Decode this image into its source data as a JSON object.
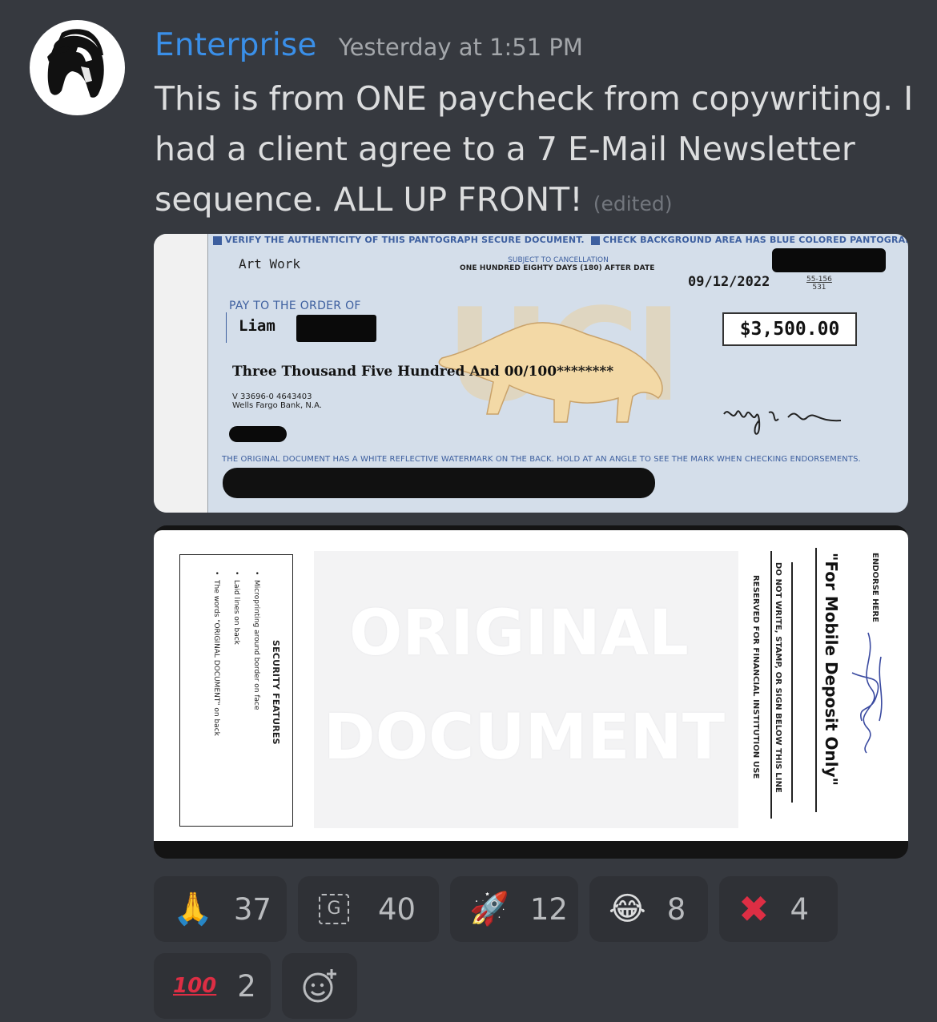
{
  "message": {
    "username": "Enterprise",
    "timestamp": "Yesterday at 1:51 PM",
    "text": "This is from ONE paycheck from copywriting. I had a client agree to a 7 E-Mail Newsletter sequence. ALL UP FRONT!",
    "edited": "(edited)",
    "avatar_icon": "spartan-helmet-icon"
  },
  "check_front": {
    "verify_line_a": "VERIFY THE AUTHENTICITY OF THIS PANTOGRAPH SECURE DOCUMENT.",
    "verify_line_b": "CHECK BACKGROUND AREA HAS BLUE COLORED PANTOGRAPH.",
    "drawer": "Art Work",
    "subject_to": "SUBJECT TO CANCELLATION",
    "days_after": "ONE HUNDRED EIGHTY DAYS (180) AFTER DATE",
    "date": "09/12/2022",
    "routing_top": "55-156",
    "routing_bottom": "531",
    "pay_to_label": "PAY TO THE ORDER OF",
    "payee": "Liam",
    "amount": "$3,500.00",
    "amount_words": "Three Thousand Five Hundred And 00/100********",
    "bank_line1": "V 33696-0  4643403",
    "bank_line2": "Wells Fargo Bank, N.A.",
    "bottom_line": "THE ORIGINAL DOCUMENT HAS A WHITE REFLECTIVE WATERMARK ON THE BACK.  HOLD AT AN ANGLE TO SEE THE MARK WHEN CHECKING ENDORSEMENTS.",
    "watermark": "UCI"
  },
  "check_back": {
    "security_title": "SECURITY FEATURES",
    "features": [
      "Microprinting around border on face",
      "Laid lines on back",
      "The words \"ORIGINAL DOCUMENT\" on back"
    ],
    "watermark_line1": "ORIGINAL",
    "watermark_line2": "DOCUMENT",
    "reserved": "RESERVED FOR FINANCIAL INSTITUTION USE",
    "do_not_write": "DO NOT WRITE, STAMP, OR SIGN BELOW THIS LINE",
    "mobile_deposit": "\"For Mobile Deposit Only\"",
    "endorse_here": "ENDORSE HERE"
  },
  "reactions": [
    {
      "icon": "folded-hands-icon",
      "count": "37"
    },
    {
      "icon": "g-emote-icon",
      "count": "40"
    },
    {
      "icon": "rocket-icon",
      "count": "12"
    },
    {
      "icon": "laughing-tears-icon",
      "count": "8"
    },
    {
      "icon": "red-x-icon",
      "count": "4"
    },
    {
      "icon": "hundred-points-icon",
      "count": "2"
    }
  ],
  "colors": {
    "background": "#36393f",
    "username": "#3a8fe8",
    "reaction_bg": "#2f3136"
  }
}
